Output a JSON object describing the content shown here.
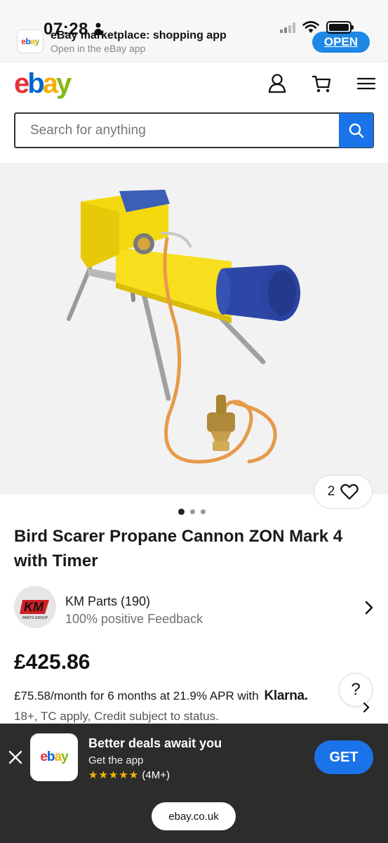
{
  "status_bar": {
    "time": "07:28"
  },
  "app_banner": {
    "logo_text": "ebay",
    "title": "eBay marketplace: shopping app",
    "subtitle": "Open in the eBay app",
    "open_label": "OPEN"
  },
  "header": {
    "logo": {
      "e": "e",
      "b": "b",
      "a": "a",
      "y": "y"
    },
    "icons": [
      "account-icon",
      "cart-icon",
      "menu-icon"
    ]
  },
  "search": {
    "placeholder": "Search for anything"
  },
  "gallery": {
    "watch_count": "2",
    "image_count": 3,
    "active_index": 0
  },
  "product": {
    "title": "Bird Scarer Propane Cannon ZON Mark 4 with Timer",
    "seller_name": "KM Parts (190)",
    "seller_feedback": "100% positive Feedback",
    "seller_logo_text": "KM",
    "seller_logo_sub": "PARTS GROUP",
    "price": "£425.86",
    "klarna_text": "£75.58/month for 6 months at 21.9% APR with",
    "klarna_brand": "Klarna.",
    "terms": "18+, TC apply, Credit subject to status."
  },
  "help": {
    "label": "?"
  },
  "promo": {
    "logo_text": "ebay",
    "title": "Better deals await you",
    "subtitle": "Get the app",
    "stars": "★★★★★",
    "rating_count": "(4M+)",
    "get_label": "GET",
    "url": "ebay.co.uk"
  },
  "colors": {
    "accent": "#1a73e8",
    "promo_bg": "#2c2c2c",
    "star": "#f5b800"
  }
}
